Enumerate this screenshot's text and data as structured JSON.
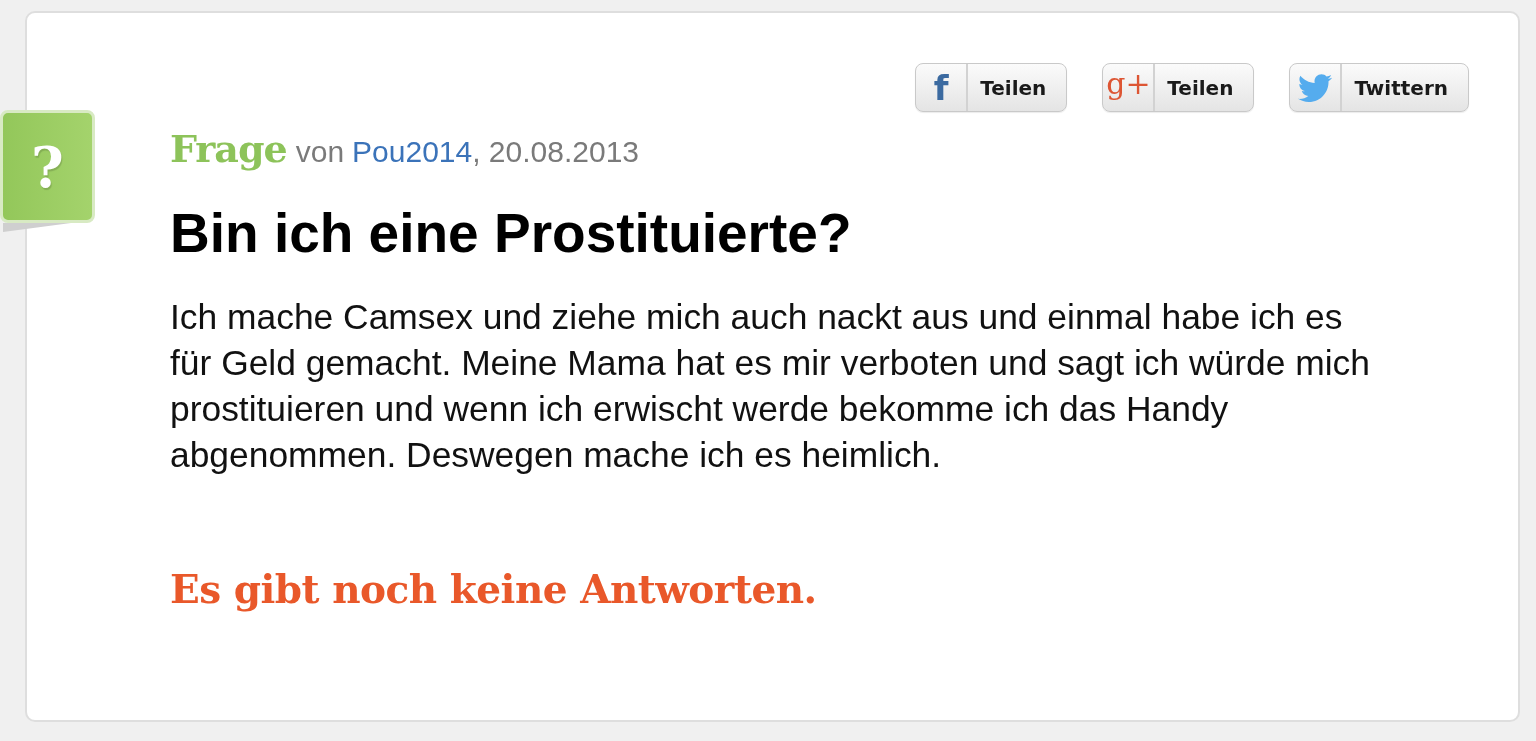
{
  "share_buttons": [
    {
      "kind": "facebook",
      "glyph": "f",
      "label": "Teilen"
    },
    {
      "kind": "googleplus",
      "glyph": "g+",
      "label": "Teilen"
    },
    {
      "kind": "twitter",
      "label": "Twittern"
    }
  ],
  "badge": {
    "glyph": "?"
  },
  "question": {
    "type_label": "Frage",
    "by": "von",
    "author": "Pou2014",
    "date": ", 20.08.2013",
    "title": "Bin ich eine Prostituierte?",
    "body": "Ich mache Camsex und ziehe mich auch nackt aus und einmal habe ich es für Geld gemacht. Meine Mama hat es mir verboten und sagt ich würde mich prostituieren und wenn ich erwischt werde bekomme ich das Handy abgenommen. Deswegen mache ich es heimlich."
  },
  "answers_notice": "Es gibt noch keine Antworten."
}
